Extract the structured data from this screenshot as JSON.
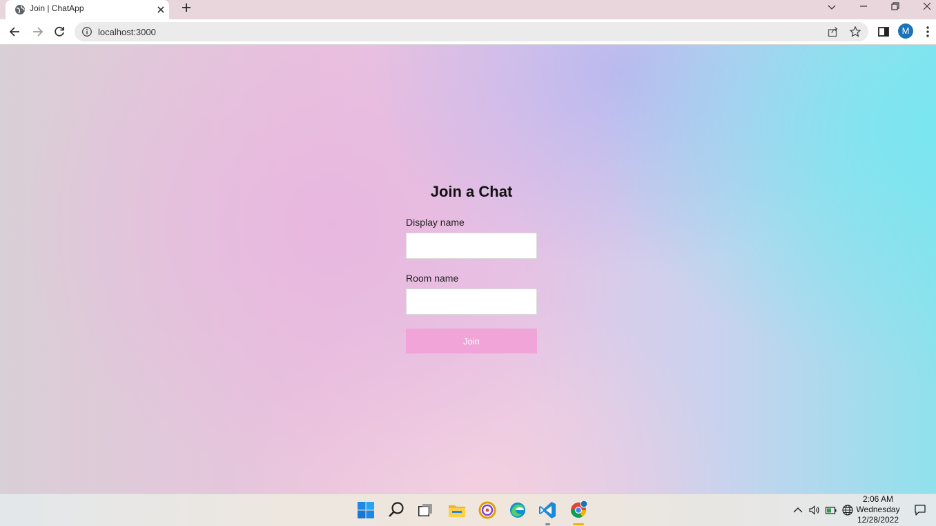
{
  "browser": {
    "tab_title": "Join | ChatApp",
    "url": "localhost:3000",
    "profile_initial": "M"
  },
  "page": {
    "title": "Join a Chat",
    "display_name_label": "Display name",
    "display_name_value": "",
    "room_name_label": "Room name",
    "room_name_value": "",
    "join_label": "Join"
  },
  "taskbar": {
    "time": "2:06 AM",
    "day": "Wednesday",
    "date": "12/28/2022",
    "apps": [
      "start-icon",
      "search-icon",
      "task-view-icon",
      "file-explorer-icon",
      "app-icon",
      "edge-icon",
      "vscode-icon",
      "chrome-icon"
    ]
  },
  "colors": {
    "join_button": "#f0a4d8",
    "avatar": "#1a73b8"
  }
}
